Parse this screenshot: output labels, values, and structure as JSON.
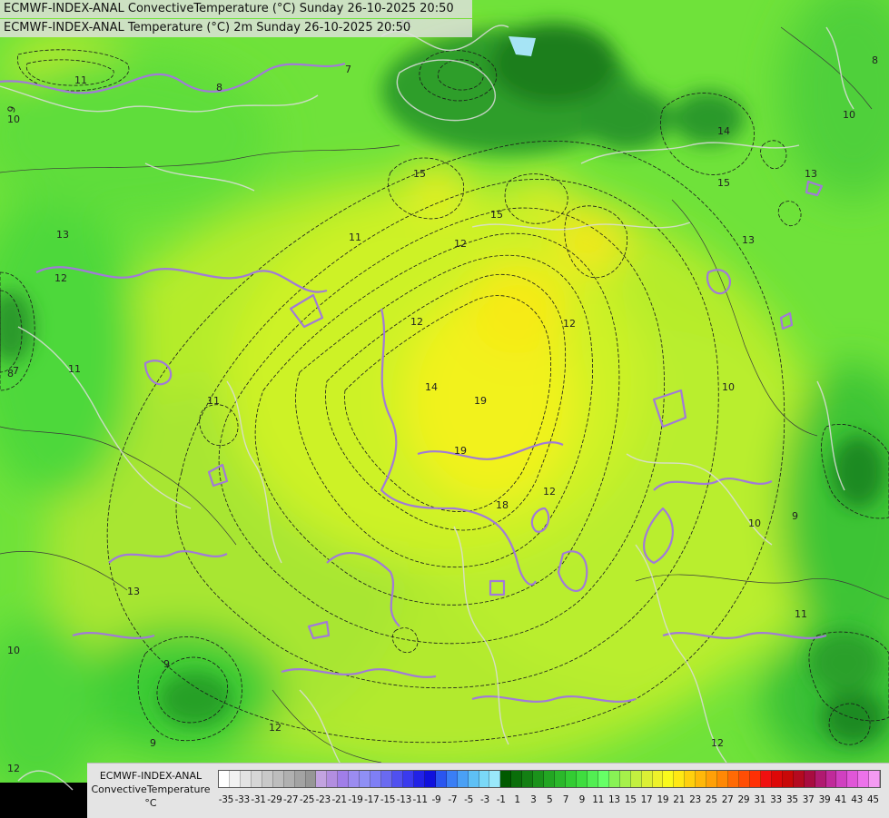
{
  "header": {
    "line1": "ECMWF-INDEX-ANAL ConvectiveTemperature (°C) Sunday 26-10-2025 20:50",
    "line2": "ECMWF-INDEX-ANAL Temperature (°C) 2m Sunday 26-10-2025 20:50"
  },
  "legend": {
    "title_line1": "ECMWF-INDEX-ANAL",
    "title_line2": "ConvectiveTemperature",
    "unit": "°C",
    "colors": [
      "#ffffff",
      "#f2f2f2",
      "#e3e3e3",
      "#d6d6d6",
      "#c9c9c9",
      "#bdbdbd",
      "#b0b0b0",
      "#a3a3a3",
      "#969696",
      "#c2a3e0",
      "#b28ee0",
      "#a07ee8",
      "#9b8cf0",
      "#8f8ff5",
      "#7f7ff5",
      "#6a6af0",
      "#5050f0",
      "#3a3aee",
      "#2222e6",
      "#1010dd",
      "#2a55f0",
      "#3a7ef5",
      "#4aa0f5",
      "#5ec0f5",
      "#7ad8f7",
      "#9ae8fa",
      "#005a00",
      "#0a6e0a",
      "#137f13",
      "#1b921b",
      "#23a623",
      "#2bb82b",
      "#33cc33",
      "#3fdd3f",
      "#52ee52",
      "#66ff66",
      "#88f255",
      "#a6f04a",
      "#c3f040",
      "#dcf035",
      "#eef22a",
      "#fafa1c",
      "#ffe814",
      "#ffd00e",
      "#ffb80a",
      "#ffa008",
      "#ff8805",
      "#ff6a05",
      "#ff4e05",
      "#ff3005",
      "#f01010",
      "#dd0808",
      "#c80808",
      "#b40a20",
      "#a80c40",
      "#b01a70",
      "#c02a9a",
      "#d040c0",
      "#e056d8",
      "#ec72ea",
      "#f49af2"
    ],
    "ticks": [
      "-35",
      "-33",
      "-31",
      "-29",
      "-27",
      "-25",
      "-23",
      "-21",
      "-19",
      "-17",
      "-15",
      "-13",
      "-11",
      "-9",
      "-7",
      "-5",
      "-3",
      "-1",
      "1",
      "3",
      "5",
      "7",
      "9",
      "11",
      "13",
      "15",
      "17",
      "19",
      "21",
      "23",
      "25",
      "27",
      "29",
      "31",
      "33",
      "35",
      "37",
      "39",
      "41",
      "43",
      "45"
    ]
  },
  "contour_labels": [
    "11",
    "10",
    "9",
    "8",
    "7",
    "13",
    "12",
    "11",
    "15",
    "14",
    "15",
    "13",
    "12",
    "12",
    "11",
    "19",
    "19",
    "18",
    "14",
    "15",
    "13",
    "12",
    "12",
    "11",
    "11",
    "10",
    "9",
    "8",
    "9",
    "10",
    "12",
    "13",
    "12",
    "10",
    "9",
    "12",
    "7",
    "8",
    "10",
    "11",
    "8"
  ]
}
